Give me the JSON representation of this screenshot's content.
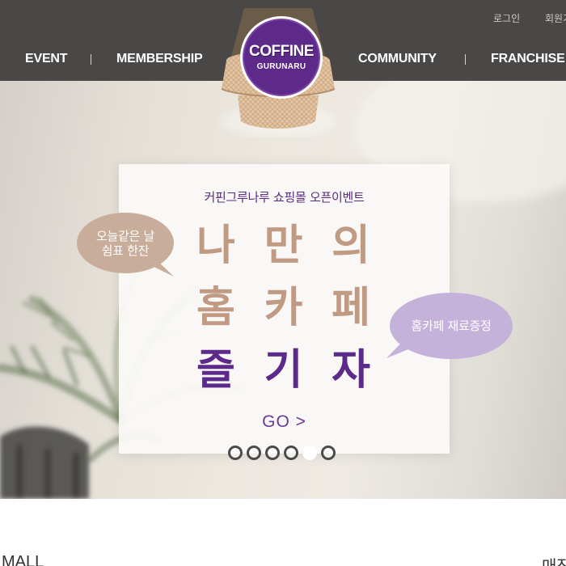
{
  "header": {
    "util_links": [
      "로그인",
      "회원가"
    ],
    "nav": [
      "EVENT",
      "MEMBERSHIP",
      "COMMUNITY",
      "FRANCHISE"
    ],
    "logo": {
      "main": "COFFINE",
      "sub": "GURUNARU"
    }
  },
  "hero": {
    "subtitle": "커핀그루나루 쇼핑몰 오픈이벤트",
    "headline_lines": [
      [
        "나",
        "만",
        "의"
      ],
      [
        "홈",
        "카",
        "페"
      ],
      [
        "즐",
        "기",
        "자"
      ]
    ],
    "go_label": "GO >",
    "bubble_left": [
      "오늘같은 날",
      "쉼표 한잔"
    ],
    "bubble_right": "홈카페 재료증정",
    "slides": {
      "count": 6,
      "active_index": 4
    }
  },
  "bottom": {
    "left_text": "MALL",
    "right_text": "매장"
  },
  "colors": {
    "header_bg": "#4a4846",
    "brand_purple": "#5e2a8a",
    "headline_tan": "#c09a82",
    "bubble_left": "#c8ad9b",
    "bubble_right": "#c5b2da"
  }
}
